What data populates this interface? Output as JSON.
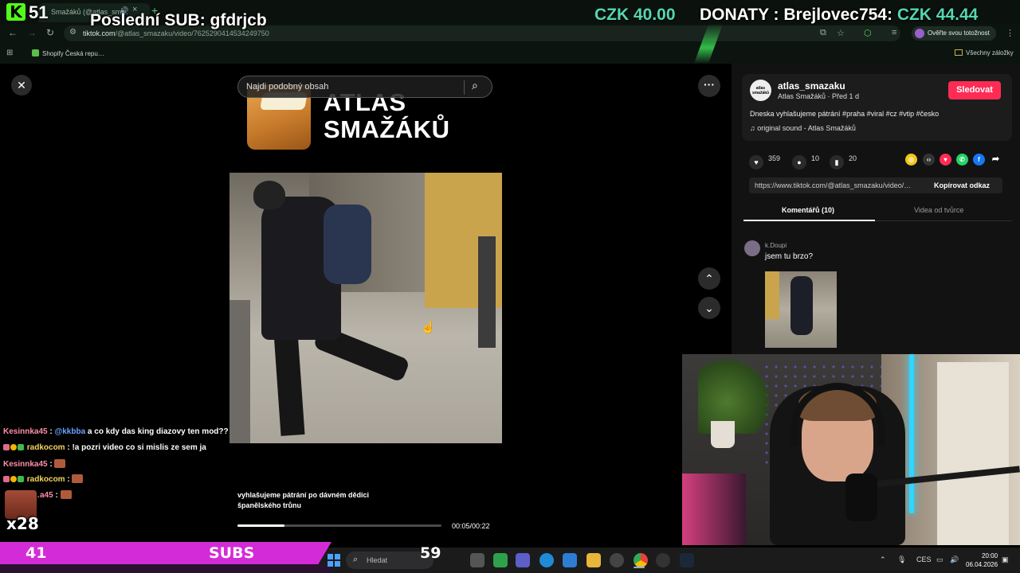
{
  "browser": {
    "tab_title": "Smažáků (@atlas_sm…",
    "url_host": "tiktok.com",
    "url_path": "/@atlas_smazaku/video/7625290414534249750",
    "verify_label": "Ověřte svou totožnost",
    "bookmark_shopify": "Shopify Česká repu…",
    "bookmark_all": "Všechny záložky"
  },
  "stream_overlay": {
    "viewer_count": "51",
    "last_sub": "Poslední SUB: gfdrjcb",
    "czk_total": "CZK 40.00",
    "donate_label": "DONATY : Brejlovec754: ",
    "donate_amount": "CZK 44.44",
    "subs_count": "41",
    "subs_label": "SUBS",
    "subs_goal": "59",
    "combo": "x28"
  },
  "video": {
    "search_placeholder": "Najdi podobný obsah",
    "logo_line1": "ATLAS",
    "logo_line2": "SMAŽÁKŮ",
    "caption_line1": "vyhlašujeme pátrání po dávném dědici",
    "caption_line2": "španělského trůnu",
    "time": "00:05/00:22",
    "progress": 0.23
  },
  "post": {
    "username": "atlas_smazaku",
    "subtitle": "Atlas Smažáků · Před 1 d",
    "follow_label": "Sledovat",
    "description": "Dneska vyhlašujeme pátrání #praha #viral #cz #vtip #česko",
    "music": "original sound - Atlas Smažáků",
    "likes": "359",
    "comments": "10",
    "saves": "20",
    "link": "https://www.tiktok.com/@atlas_smazaku/video/…",
    "copy_label": "Kopírovat odkaz",
    "tab_comments": "Komentářů (10)",
    "tab_creator": "Videa od tvůrce",
    "avatar_text": "atlas smažáků"
  },
  "comment": {
    "user": "k.Doupi",
    "text": "jsem tu brzo?"
  },
  "chat": [
    {
      "user": "Kesinnka45",
      "mention": "@kkbba",
      "text": " a co kdy das king diazovy ten mod??"
    },
    {
      "user": "radkocom",
      "mention": "",
      "text": " !a pozri video co si mislis ze sem ja"
    },
    {
      "user": "Kesinnka45",
      "mention": "",
      "text": ""
    },
    {
      "user": "radkocom",
      "mention": "",
      "text": ""
    },
    {
      "user": "…a45",
      "mention": "",
      "text": ""
    }
  ],
  "taskbar": {
    "search_placeholder": "Hledat",
    "lang": "CES",
    "time": "20:00",
    "date": "06.04.2026"
  }
}
